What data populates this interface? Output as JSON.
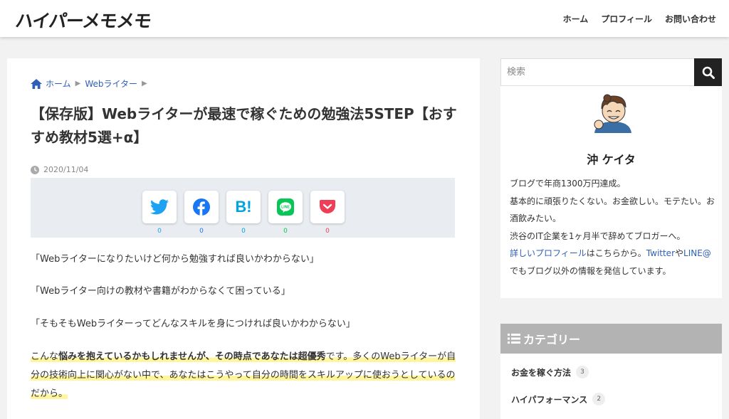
{
  "header": {
    "logo": "ハイパーメモメモ",
    "nav": [
      "ホーム",
      "プロフィール",
      "お問い合わせ"
    ]
  },
  "article": {
    "breadcrumb": [
      "ホーム",
      "Webライター"
    ],
    "title": "【保存版】Webライターが最速で稼ぐための勉強法5STEP【おすすめ教材5選+α】",
    "date": "2020/11/04",
    "share": [
      {
        "name": "twitter-icon",
        "count": "0",
        "color": "#1da1f2"
      },
      {
        "name": "facebook-icon",
        "count": "0",
        "color": "#1877f2"
      },
      {
        "name": "hatena-icon",
        "count": "0",
        "color": "#00a4de"
      },
      {
        "name": "line-icon",
        "count": "0",
        "color": "#06c755"
      },
      {
        "name": "pocket-icon",
        "count": "0",
        "color": "#ef3f56"
      }
    ],
    "quote1": "「Webライターになりたいけど何から勉強すれば良いかわからない」",
    "quote2": "「Webライター向けの教材や書籍がわからなくて困っている」",
    "quote3": "「そもそもWebライターってどんなスキルを身につければ良いかわからない」",
    "para": {
      "a": "こんな",
      "b": "悩みを抱えているかもしれませんが、その時点であなたは超優秀",
      "c": "です。多くのWebライターが自分の技術向上に関心がない中で、あなたはこうやって自分の時間をスキルアップに使おうとしているのだから。"
    }
  },
  "sidebar": {
    "search_placeholder": "検索",
    "profile": {
      "name": "沖 ケイタ",
      "bio1": "ブログで年商1300万円達成。",
      "bio2": "基本的に頑張りたくない。お金欲しい。モテたい。お酒飲みたい。",
      "bio3": "渋谷のIT企業を1ヶ月半で辞めてブロガーへ。",
      "link1": "詳しいプロフィール",
      "bio4": "はこちらから。",
      "link2": "Twitter",
      "bio5": "や",
      "link3": "LINE@",
      "bio6": " でもブログ以外の情報を発信しています。"
    },
    "categories_title": "カテゴリー",
    "categories": [
      {
        "label": "お金を稼ぐ方法",
        "count": "3"
      },
      {
        "label": "ハイパフォーマンス",
        "count": "2"
      }
    ]
  }
}
